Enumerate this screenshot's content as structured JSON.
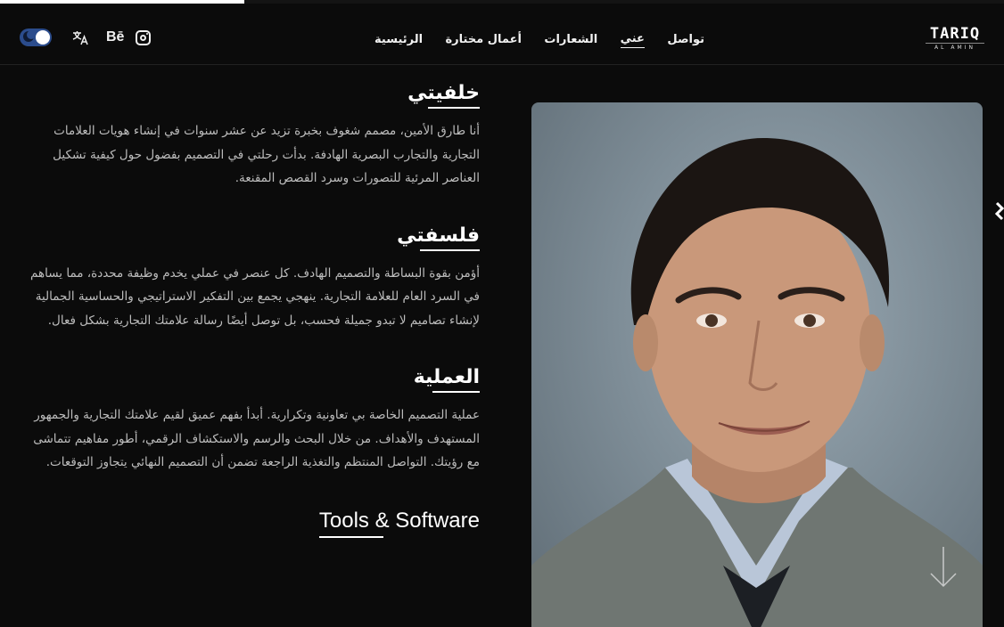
{
  "progress": {
    "fraction": 0.243
  },
  "header": {
    "logo": {
      "text": "TARIQ",
      "subtitle": "AL AMIN"
    },
    "nav": [
      {
        "label": "الرئيسية",
        "active": false
      },
      {
        "label": "أعمال مختارة",
        "active": false
      },
      {
        "label": "الشعارات",
        "active": false
      },
      {
        "label": "عني",
        "active": true
      },
      {
        "label": "تواصل",
        "active": false
      }
    ],
    "icons": {
      "theme_toggle": "theme-toggle-icon",
      "translate": "translate-icon",
      "behance_text": "Bē",
      "instagram": "instagram-icon"
    }
  },
  "sections": {
    "background": {
      "title": "خلفيتي",
      "text": "أنا طارق الأمين، مصمم شغوف بخبرة تزيد عن عشر سنوات في إنشاء هويات العلامات التجارية والتجارب البصرية الهادفة. بدأت رحلتي في التصميم بفضول حول كيفية تشكيل العناصر المرئية للتصورات وسرد القصص المقنعة."
    },
    "philosophy": {
      "title": "فلسفتي",
      "text": "أؤمن بقوة البساطة والتصميم الهادف. كل عنصر في عملي يخدم وظيفة محددة، مما يساهم في السرد العام للعلامة التجارية. ينهجي يجمع بين التفكير الاستراتيجي والحساسية الجمالية لإنشاء تصاميم لا تبدو جميلة فحسب، بل توصل أيضًا رسالة علامتك التجارية بشكل فعال."
    },
    "process": {
      "title": "العملية",
      "text": "عملية التصميم الخاصة بي تعاونية وتكرارية. أبدأ بفهم عميق لقيم علامتك التجارية والجمهور المستهدف والأهداف. من خلال البحث والرسم والاستكشاف الرقمي، أطور مفاهيم تتماشى مع رؤيتك. التواصل المنتظم والتغذية الراجعة تضمن أن التصميم النهائي يتجاوز التوقعات."
    },
    "tools": {
      "title": "Tools & Software"
    }
  },
  "portrait": {
    "subject": "portrait-photo"
  },
  "colors": {
    "background": "#0b0b0b",
    "text": "#bdbdbd",
    "heading": "#ffffff",
    "toggle": "#2b4c8c"
  }
}
